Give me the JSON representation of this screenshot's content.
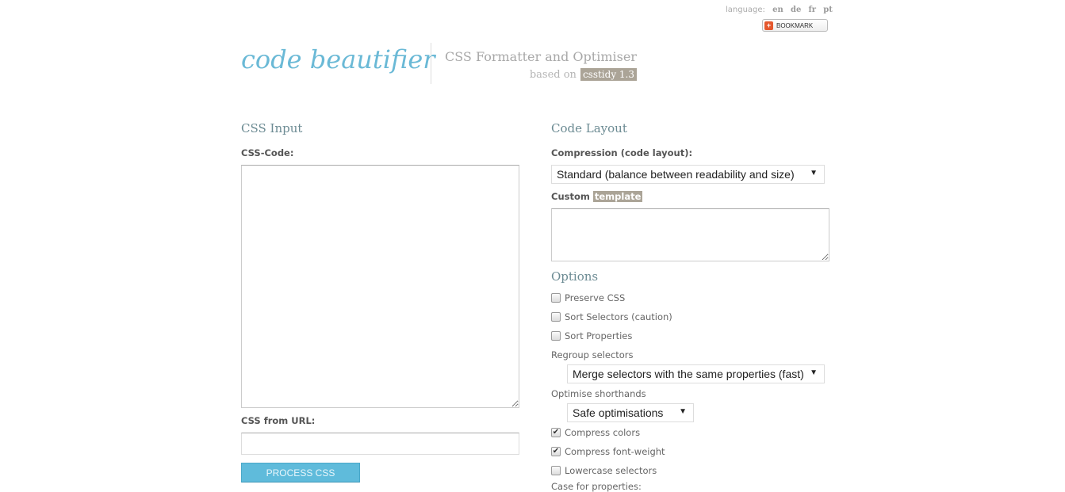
{
  "header": {
    "language_label": "language:",
    "languages": [
      "en",
      "de",
      "fr",
      "pt"
    ],
    "bookmark_label": "BOOKMARK",
    "logo": "code beautifier",
    "tagline": "CSS Formatter and Optimiser",
    "based_on": "based on",
    "csstidy_badge": "csstidy 1.3"
  },
  "input_section": {
    "title": "CSS Input",
    "css_code_label": "CSS-Code:",
    "css_code_value": "",
    "css_url_label": "CSS from URL:",
    "css_url_value": "",
    "process_button": "PROCESS CSS"
  },
  "layout_section": {
    "title": "Code Layout",
    "compression_label": "Compression (code layout):",
    "compression_selected": "Standard (balance between readability and size)",
    "custom_label": "Custom",
    "template_badge": "template",
    "custom_template_value": ""
  },
  "options_section": {
    "title": "Options",
    "checkboxes_top": [
      {
        "label": "Preserve CSS",
        "checked": false
      },
      {
        "label": "Sort Selectors (caution)",
        "checked": false
      },
      {
        "label": "Sort Properties",
        "checked": false
      }
    ],
    "regroup_label": "Regroup selectors",
    "regroup_selected": "Merge selectors with the same properties (fast)",
    "shorthands_label": "Optimise shorthands",
    "shorthands_selected": "Safe optimisations",
    "checkboxes_bottom": [
      {
        "label": "Compress colors",
        "checked": true
      },
      {
        "label": "Compress font-weight",
        "checked": true
      },
      {
        "label": "Lowercase selectors",
        "checked": false
      }
    ],
    "case_label": "Case for properties:"
  },
  "icons": {
    "caret": "▼",
    "check": "✔",
    "bookmark": "+"
  }
}
